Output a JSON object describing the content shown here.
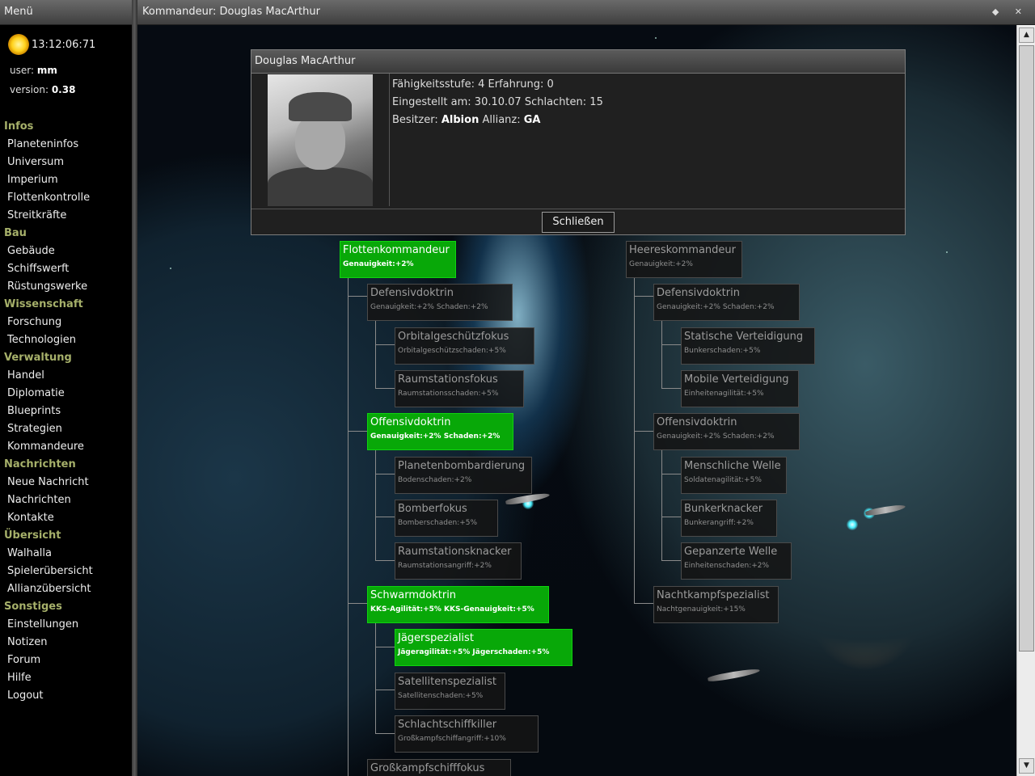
{
  "sidebar": {
    "title": "Menü",
    "clock": "13:12:06:71",
    "user_label": "user:",
    "user_value": "mm",
    "version_label": "version:",
    "version_value": "0.38",
    "sections": [
      {
        "title": "Infos",
        "items": [
          "Planeteninfos",
          "Universum",
          "Imperium",
          "Flottenkontrolle",
          "Streitkräfte"
        ]
      },
      {
        "title": "Bau",
        "items": [
          "Gebäude",
          "Schiffswerft",
          "Rüstungswerke"
        ]
      },
      {
        "title": "Wissenschaft",
        "items": [
          "Forschung",
          "Technologien"
        ]
      },
      {
        "title": "Verwaltung",
        "items": [
          "Handel",
          "Diplomatie",
          "Blueprints",
          "Strategien",
          "Kommandeure"
        ]
      },
      {
        "title": "Nachrichten",
        "items": [
          "Neue Nachricht",
          "Nachrichten",
          "Kontakte"
        ]
      },
      {
        "title": "Übersicht",
        "items": [
          "Walhalla",
          "Spielerübersicht",
          "Allianzübersicht"
        ]
      },
      {
        "title": "Sonstiges",
        "items": [
          "Einstellungen",
          "Notizen",
          "Forum",
          "Hilfe",
          "Logout"
        ]
      }
    ]
  },
  "window": {
    "title": "Kommandeur: Douglas MacArthur",
    "controls": "◆ ✕"
  },
  "dialog": {
    "title": "Douglas MacArthur",
    "skill_label": "Fähigkeitsstufe:",
    "skill_value": "4",
    "exp_label": "Erfahrung:",
    "exp_value": "0",
    "hired_label": "Eingestellt am:",
    "hired_value": "30.10.07",
    "battles_label": "Schlachten:",
    "battles_value": "15",
    "owner_label": "Besitzer:",
    "owner_value": "Albion",
    "alliance_label": "Allianz:",
    "alliance_value": "GA",
    "close_button": "Schließen"
  },
  "tree": {
    "fleet": {
      "root": {
        "title": "Flottenkommandeur",
        "desc": "Genauigkeit:+2%",
        "active": true
      },
      "defensive": {
        "title": "Defensivdoktrin",
        "desc": "Genauigkeit:+2% Schaden:+2%",
        "active": false
      },
      "orbital": {
        "title": "Orbitalgeschützfokus",
        "desc": "Orbitalgeschützschaden:+5%",
        "active": false
      },
      "station_focus": {
        "title": "Raumstationsfokus",
        "desc": "Raumstationsschaden:+5%",
        "active": false
      },
      "offensive": {
        "title": "Offensivdoktrin",
        "desc": "Genauigkeit:+2% Schaden:+2%",
        "active": true
      },
      "bombard": {
        "title": "Planetenbombardierung",
        "desc": "Bodenschaden:+2%",
        "active": false
      },
      "bomber": {
        "title": "Bomberfokus",
        "desc": "Bomberschaden:+5%",
        "active": false
      },
      "station_cracker": {
        "title": "Raumstationsknacker",
        "desc": "Raumstationsangriff:+2%",
        "active": false
      },
      "swarm": {
        "title": "Schwarmdoktrin",
        "desc": "KKS-Agilität:+5% KKS-Genauigkeit:+5%",
        "active": true
      },
      "fighter": {
        "title": "Jägerspezialist",
        "desc": "Jägeragilität:+5% Jägerschaden:+5%",
        "active": true
      },
      "satellite": {
        "title": "Satellitenspezialist",
        "desc": "Satellitenschaden:+5%",
        "active": false
      },
      "battleship": {
        "title": "Schlachtschiffkiller",
        "desc": "Großkampfschiffangriff:+10%",
        "active": false
      },
      "capital": {
        "title": "Großkampfschifffokus",
        "desc": "",
        "active": false
      }
    },
    "army": {
      "root": {
        "title": "Heereskommandeur",
        "desc": "Genauigkeit:+2%",
        "active": false
      },
      "defensive": {
        "title": "Defensivdoktrin",
        "desc": "Genauigkeit:+2% Schaden:+2%",
        "active": false
      },
      "static_def": {
        "title": "Statische Verteidigung",
        "desc": "Bunkerschaden:+5%",
        "active": false
      },
      "mobile_def": {
        "title": "Mobile Verteidigung",
        "desc": "Einheitenagilität:+5%",
        "active": false
      },
      "offensive": {
        "title": "Offensivdoktrin",
        "desc": "Genauigkeit:+2% Schaden:+2%",
        "active": false
      },
      "human_wave": {
        "title": "Menschliche Welle",
        "desc": "Soldatenagilität:+5%",
        "active": false
      },
      "bunker_cracker": {
        "title": "Bunkerknacker",
        "desc": "Bunkerangriff:+2%",
        "active": false
      },
      "armored_wave": {
        "title": "Gepanzerte Welle",
        "desc": "Einheitenschaden:+2%",
        "active": false
      },
      "night": {
        "title": "Nachtkampfspezialist",
        "desc": "Nachtgenauigkeit:+15%",
        "active": false
      }
    }
  }
}
